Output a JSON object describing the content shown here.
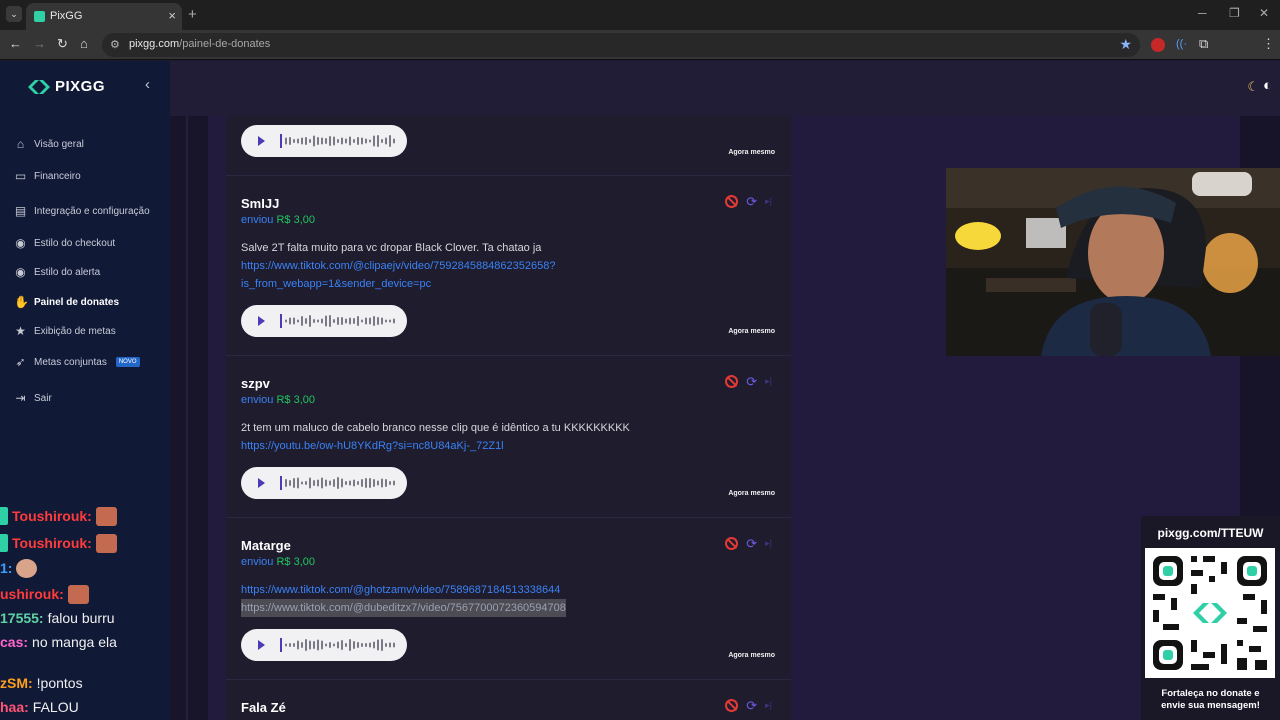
{
  "browser": {
    "tab_title": "PixGG",
    "tab_close": "×",
    "new_tab": "+",
    "url_host": "pixgg.com",
    "url_path": "/painel-de-donates",
    "profile_initial": "M"
  },
  "sidebar": {
    "brand": "PIXGG",
    "items": [
      {
        "label": "Visão geral",
        "icon": "home-icon"
      },
      {
        "label": "Financeiro",
        "icon": "wallet-icon"
      },
      {
        "label": "Integração e configuração",
        "icon": "settings-icon"
      },
      {
        "label": "Estilo do checkout",
        "icon": "palette-icon"
      },
      {
        "label": "Estilo do alerta",
        "icon": "palette-icon"
      },
      {
        "label": "Painel de donates",
        "icon": "donate-icon",
        "active": true
      },
      {
        "label": "Exibição de metas",
        "icon": "star-icon"
      },
      {
        "label": "Metas conjuntas",
        "icon": "target-icon",
        "badge": "NOVO"
      },
      {
        "label": "Sair",
        "icon": "logout-icon"
      }
    ]
  },
  "chat": [
    {
      "user": "Toushirouk:",
      "msg": "",
      "color": "#ff3b3b"
    },
    {
      "user": "Toushirouk:",
      "msg": "",
      "color": "#ff3b3b"
    },
    {
      "user": "1:",
      "msg": "",
      "color": "#3aa0ff"
    },
    {
      "user": "ushirouk:",
      "msg": "",
      "color": "#ff3b3b"
    },
    {
      "user": "17555:",
      "msg": "falou burru",
      "color": "#5fd3a5"
    },
    {
      "user": "cas:",
      "msg": "no manga ela",
      "color": "#ff66cc"
    },
    {
      "user": "zSM:",
      "msg": "!pontos",
      "color": "#ff9f1a"
    },
    {
      "user": "haa:",
      "msg": "FALOU",
      "color": "#ff5577"
    }
  ],
  "donations": [
    {
      "name": "",
      "sent": "",
      "amount": "",
      "lines": [],
      "time": "Agora mesmo"
    },
    {
      "name": "SmIJJ",
      "sent": "enviou",
      "amount": "R$ 3,00",
      "lines": [
        {
          "type": "text",
          "value": "Salve 2T falta muito para vc dropar Black Clover. Ta chatao ja"
        },
        {
          "type": "link",
          "value": "https://www.tiktok.com/@clipaejv/video/7592845884862352658?"
        },
        {
          "type": "link",
          "value": "is_from_webapp=1&sender_device=pc"
        }
      ],
      "time": "Agora mesmo"
    },
    {
      "name": "szpv",
      "sent": "enviou",
      "amount": "R$ 3,00",
      "lines": [
        {
          "type": "text",
          "value": "2t tem um maluco de cabelo branco nesse clip que é idêntico a tu KKKKKKKKK"
        },
        {
          "type": "link",
          "value": "https://youtu.be/ow-hU8YKdRg?si=nc8U84aKj-_72Z1l"
        }
      ],
      "time": "Agora mesmo"
    },
    {
      "name": "Matarge",
      "sent": "enviou",
      "amount": "R$ 3,00",
      "lines": [
        {
          "type": "link",
          "value": "https://www.tiktok.com/@ghotzamv/video/7589687184513338644"
        },
        {
          "type": "link-selected",
          "value": "https://www.tiktok.com/@dubeditzx7/video/7567700072360594708"
        }
      ],
      "time": "Agora mesmo"
    },
    {
      "name": "Fala Zé",
      "sent": "",
      "amount": "",
      "lines": [],
      "time": ""
    }
  ],
  "qr_panel": {
    "title": "pixgg.com/TTEUW",
    "caption_1": "Fortaleça no donate e",
    "caption_2": "envie sua mensagem!"
  },
  "colors": {
    "brand_teal": "#2fd0a6",
    "link_blue": "#3b82f6",
    "amount_green": "#22c55e",
    "block_red": "#e53935",
    "replay_purple": "#6d5ce6"
  }
}
